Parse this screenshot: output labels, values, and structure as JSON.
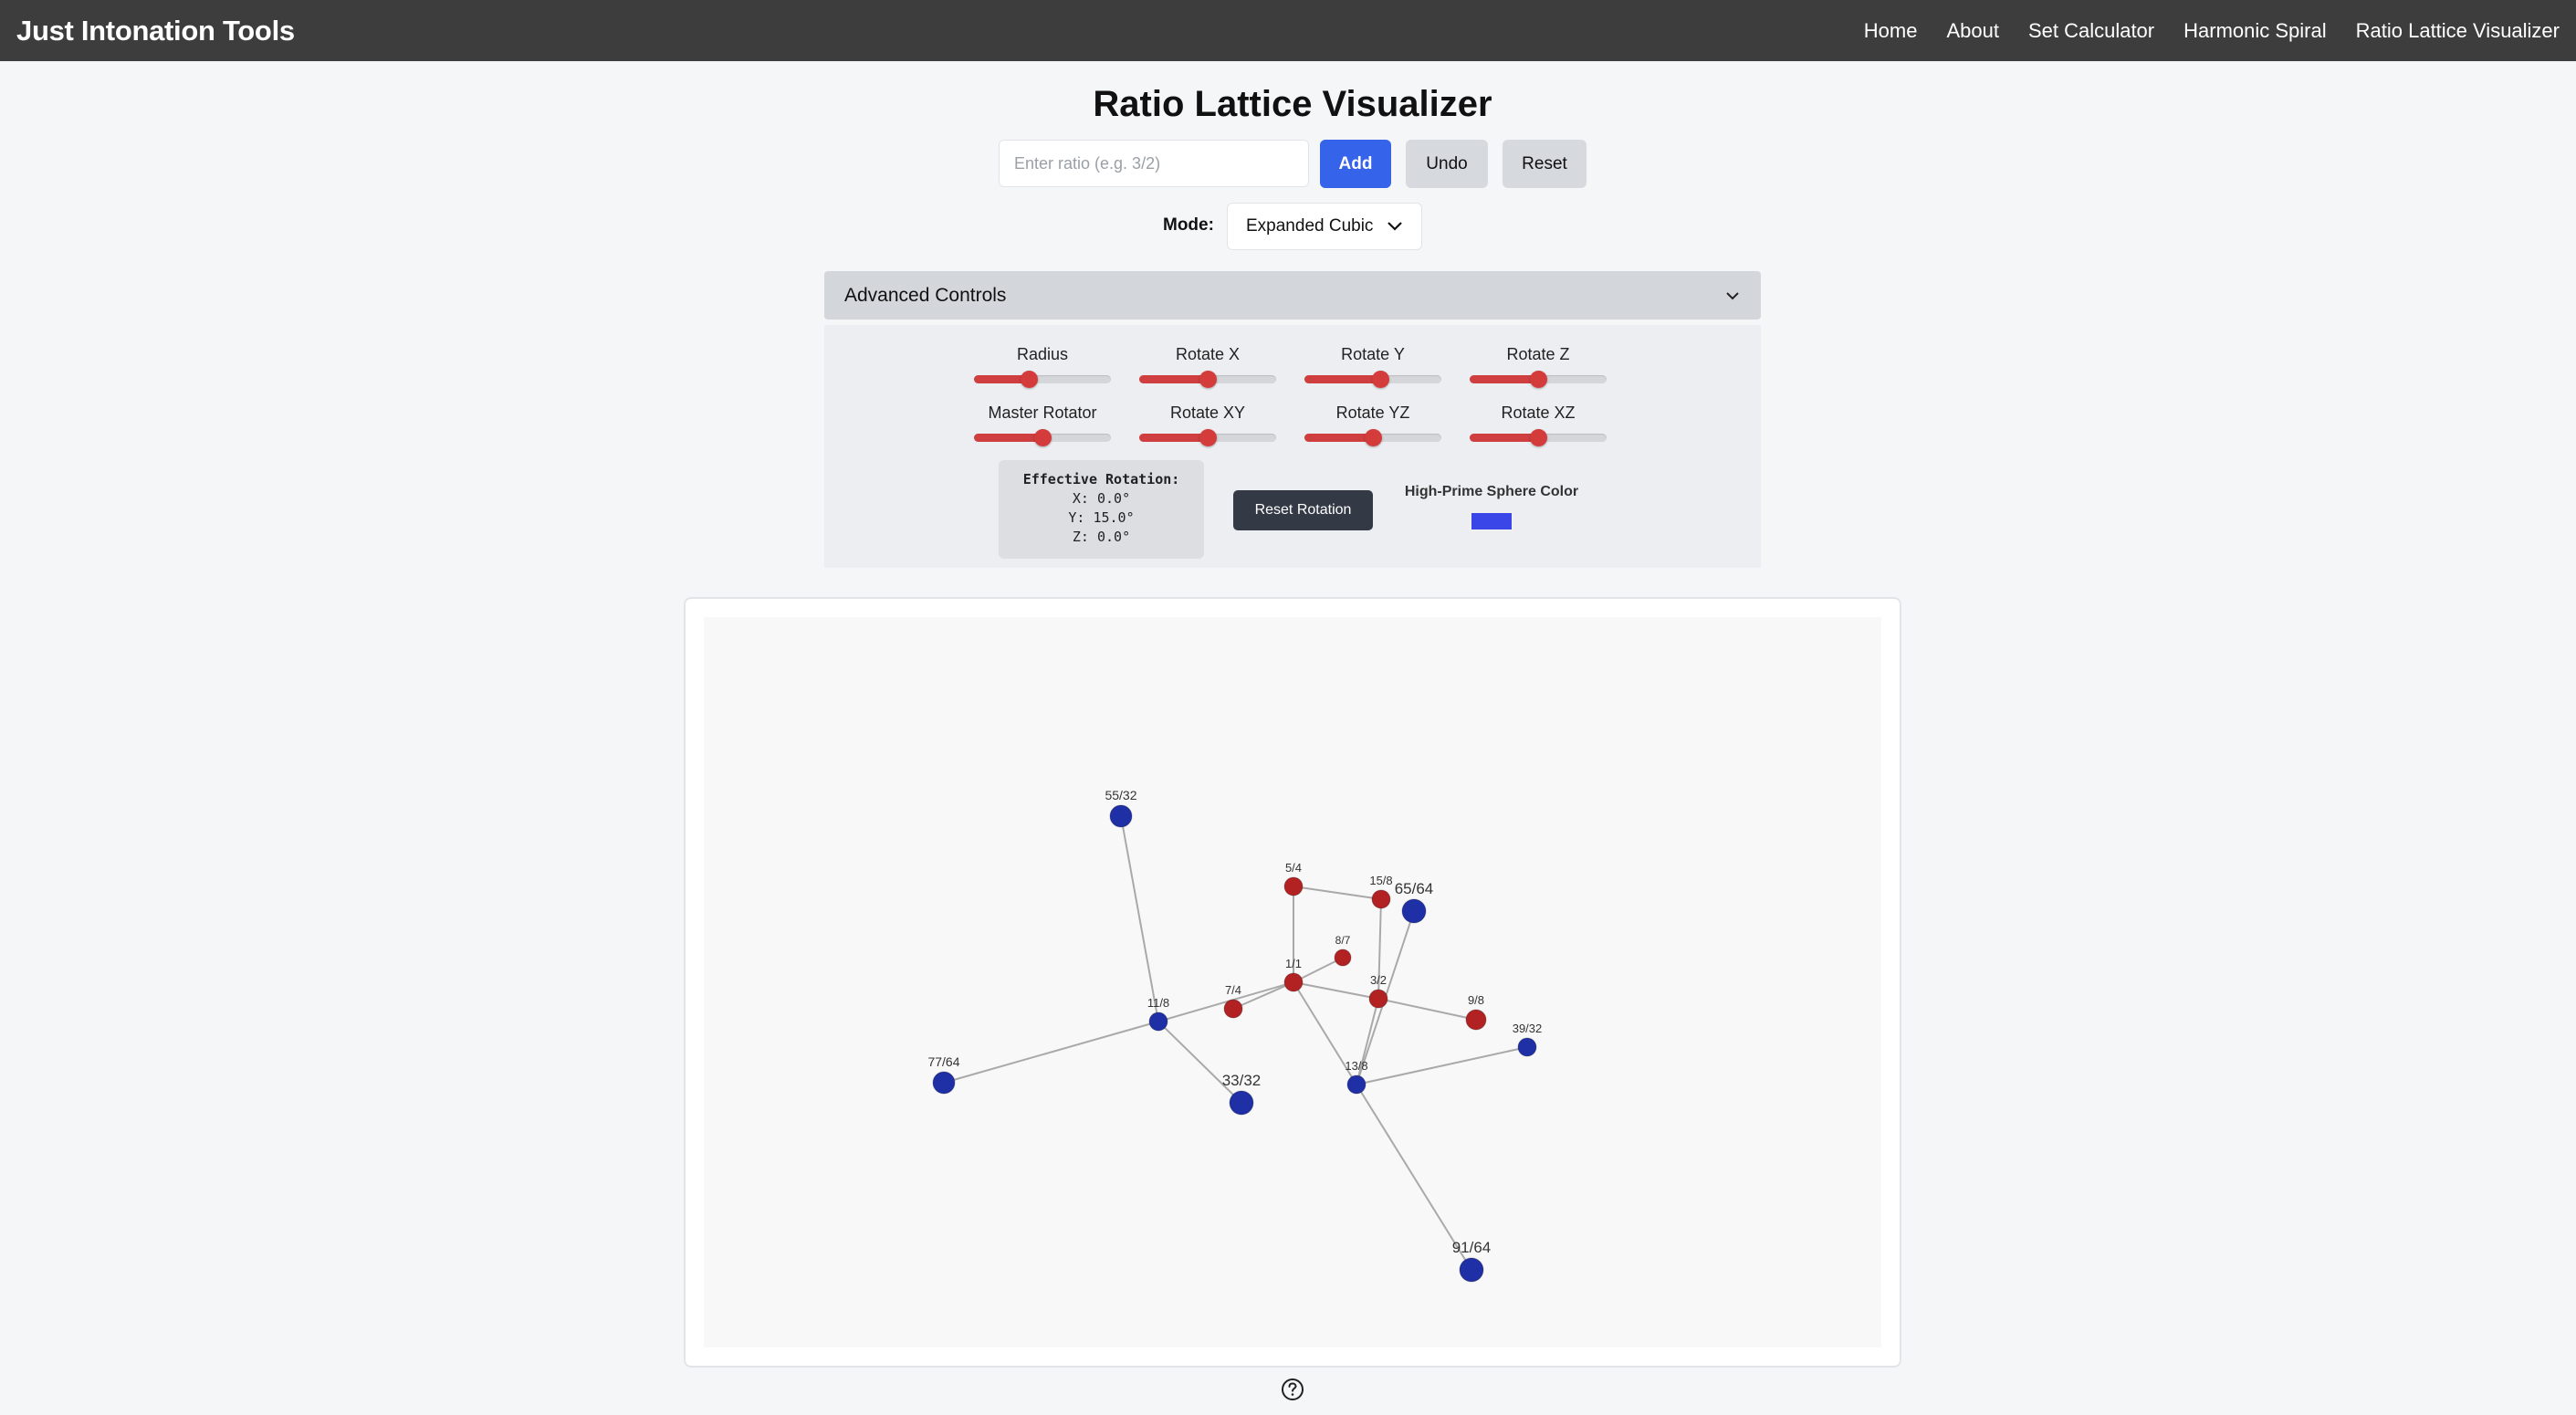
{
  "app": {
    "title": "Just Intonation Tools"
  },
  "nav": [
    {
      "label": "Home"
    },
    {
      "label": "About"
    },
    {
      "label": "Set Calculator"
    },
    {
      "label": "Harmonic Spiral"
    },
    {
      "label": "Ratio Lattice Visualizer"
    }
  ],
  "page": {
    "title": "Ratio Lattice Visualizer"
  },
  "ratio_input": {
    "placeholder": "Enter ratio (e.g. 3/2)",
    "value": ""
  },
  "buttons": {
    "add": "Add",
    "undo": "Undo",
    "reset": "Reset"
  },
  "mode": {
    "label": "Mode:",
    "selected": "Expanded Cubic"
  },
  "advanced": {
    "title": "Advanced Controls",
    "sliders": [
      {
        "label": "Radius",
        "fraction": 0.4
      },
      {
        "label": "Rotate X",
        "fraction": 0.5
      },
      {
        "label": "Rotate Y",
        "fraction": 0.55
      },
      {
        "label": "Rotate Z",
        "fraction": 0.5
      },
      {
        "label": "Master Rotator",
        "fraction": 0.5
      },
      {
        "label": "Rotate XY",
        "fraction": 0.5
      },
      {
        "label": "Rotate YZ",
        "fraction": 0.5
      },
      {
        "label": "Rotate XZ",
        "fraction": 0.5
      }
    ],
    "effective_rotation": {
      "title": "Effective Rotation:",
      "x": "X: 0.0°",
      "y": "Y: 15.0°",
      "z": "Z: 0.0°"
    },
    "reset_rotation": "Reset Rotation",
    "high_prime_color_label": "High-Prime Sphere Color",
    "high_prime_color": "#3a46e8"
  },
  "colors": {
    "low_prime_node": "#b22222",
    "high_prime_node": "#1f2fa6",
    "edge": "#a9a9a9",
    "accent_button": "#3563e9",
    "slider": "#cf3f3f"
  },
  "lattice": {
    "nodes": [
      {
        "id": "1/1",
        "label": "1/1",
        "type": "low"
      },
      {
        "id": "3/2",
        "label": "3/2",
        "type": "low"
      },
      {
        "id": "5/4",
        "label": "5/4",
        "type": "low"
      },
      {
        "id": "15/8",
        "label": "15/8",
        "type": "low"
      },
      {
        "id": "8/7",
        "label": "8/7",
        "type": "low"
      },
      {
        "id": "7/4",
        "label": "7/4",
        "type": "low"
      },
      {
        "id": "9/8",
        "label": "9/8",
        "type": "low"
      },
      {
        "id": "11/8",
        "label": "11/8",
        "type": "high"
      },
      {
        "id": "13/8",
        "label": "13/8",
        "type": "high"
      },
      {
        "id": "55/32",
        "label": "55/32",
        "type": "high"
      },
      {
        "id": "77/64",
        "label": "77/64",
        "type": "high"
      },
      {
        "id": "33/32",
        "label": "33/32",
        "type": "high"
      },
      {
        "id": "65/64",
        "label": "65/64",
        "type": "high"
      },
      {
        "id": "39/32",
        "label": "39/32",
        "type": "high"
      },
      {
        "id": "91/64",
        "label": "91/64",
        "type": "high"
      }
    ],
    "edges": [
      [
        "1/1",
        "3/2"
      ],
      [
        "1/1",
        "5/4"
      ],
      [
        "1/1",
        "8/7"
      ],
      [
        "1/1",
        "7/4"
      ],
      [
        "1/1",
        "11/8"
      ],
      [
        "1/1",
        "13/8"
      ],
      [
        "5/4",
        "15/8"
      ],
      [
        "15/8",
        "3/2"
      ],
      [
        "3/2",
        "9/8"
      ],
      [
        "3/2",
        "13/8"
      ],
      [
        "13/8",
        "65/64"
      ],
      [
        "13/8",
        "39/32"
      ],
      [
        "13/8",
        "91/64"
      ],
      [
        "11/8",
        "55/32"
      ],
      [
        "11/8",
        "77/64"
      ],
      [
        "11/8",
        "33/32"
      ]
    ]
  }
}
